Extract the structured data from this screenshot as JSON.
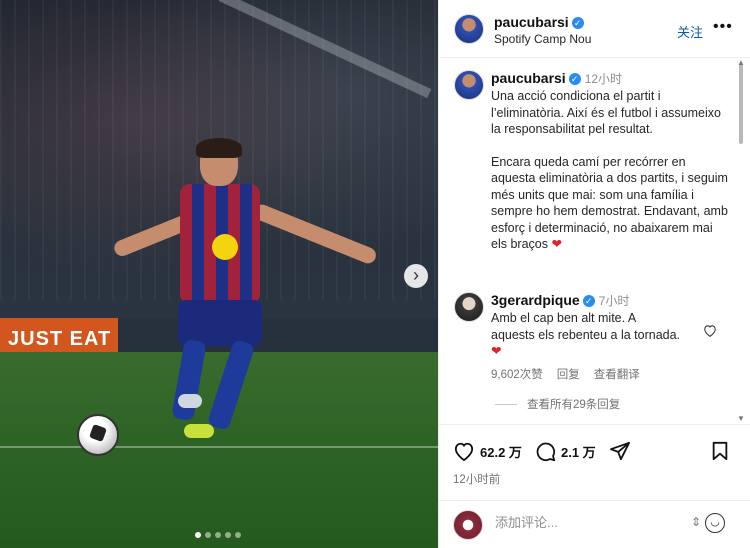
{
  "post": {
    "author": "paucubarsi",
    "location": "Spotify Camp Nou",
    "follow_label": "关注",
    "more_label": "•••",
    "photo_board_text": "JUST EAT",
    "carousel_dots": 5,
    "active_dot": 0,
    "caption": {
      "time": "12小时",
      "paragraph1": "Una acció condiciona el partit i l’eliminatòria. Així és el futbol i assumeixo la responsabilitat pel resultat.",
      "paragraph2": "Encara queda camí per recórrer en aquesta eliminatòria a dos partits, i seguim més units que mai: som una família i sempre ho hem demostrat. Endavant, amb esforç i determinació, no abaixarem mai els braços",
      "emoji": "❤"
    },
    "comment": {
      "author": "3gerardpique",
      "time": "7小时",
      "text": "Amb el cap ben alt mite. A aquests els rebenteu a la tornada.",
      "emoji": "❤",
      "likes": "9,602次赞",
      "reply_label": "回复",
      "translate_label": "查看翻译",
      "view_replies": "查看所有29条回复"
    },
    "stats": {
      "likes": "62.2 万",
      "comments": "2.1 万"
    },
    "posted_ago": "12小时前",
    "add_comment_placeholder": "添加评论...",
    "colors": {
      "verified_blue": "#2a8cf0",
      "follow_blue": "#0b5cad",
      "heart_red": "#e0202d"
    }
  }
}
